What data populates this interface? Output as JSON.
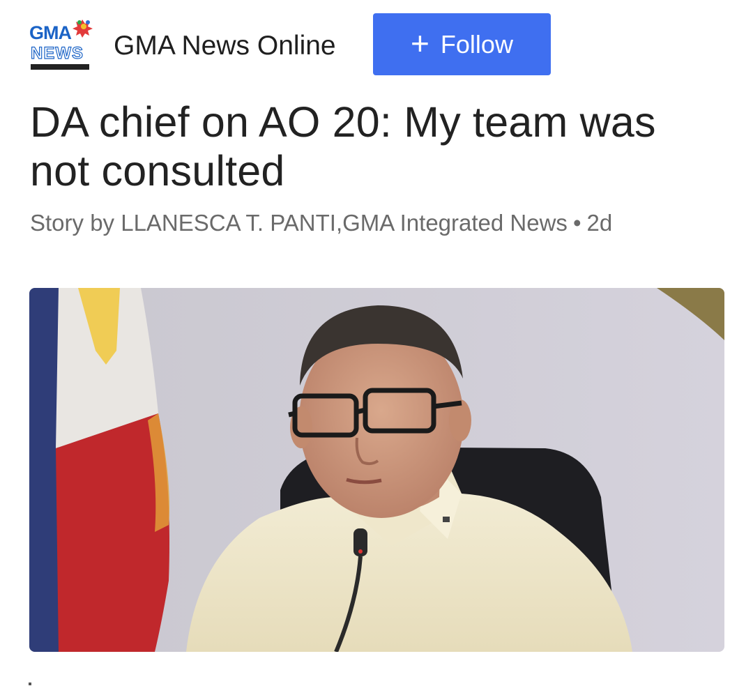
{
  "header": {
    "logo_top_text": "GMA",
    "logo_bottom_text": "NEWS",
    "source_name": "GMA News Online",
    "follow_icon": "plus-icon",
    "follow_label": "Follow",
    "follow_color": "#3f6ff0"
  },
  "article": {
    "headline": "DA chief on AO 20: My team was not consulted",
    "byline": "Story by LLANESCA T. PANTI,GMA Integrated News",
    "age": "2d"
  }
}
